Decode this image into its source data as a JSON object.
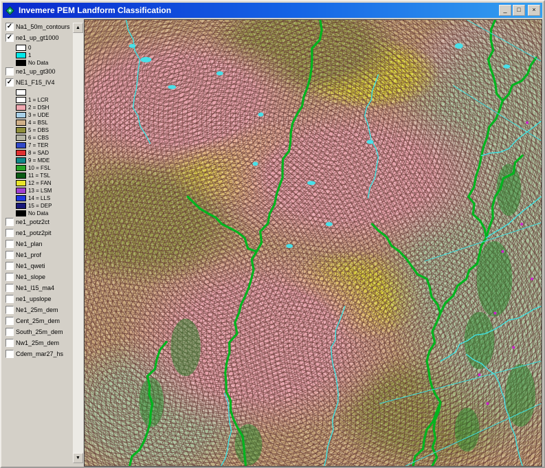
{
  "window": {
    "title": "Invemere PEM Landform Classification"
  },
  "icons": {
    "minimize": "_",
    "maximize": "□",
    "close": "×",
    "scroll_up": "▲",
    "scroll_down": "▼",
    "checkmark": "✓",
    "app_icon": "green-diamond"
  },
  "toc": {
    "layers": [
      {
        "name": "Na1_50m_contours",
        "checked": true,
        "legend": []
      },
      {
        "name": "ne1_up_gt1000",
        "checked": true,
        "legend": [
          {
            "label": "0",
            "color": "#ffffff"
          },
          {
            "label": "1",
            "color": "#00e8e8"
          },
          {
            "label": "No Data",
            "color": "#000000"
          }
        ]
      },
      {
        "name": "ne1_up_gt300",
        "checked": false,
        "legend": []
      },
      {
        "name": "NE1_F15_IV4",
        "checked": true,
        "legend": [
          {
            "label": "",
            "color": "#ffffff"
          },
          {
            "label": "1 = LCR",
            "color": "#ffffff"
          },
          {
            "label": "2 = DSH",
            "color": "#f0a8b0"
          },
          {
            "label": "3 = UDE",
            "color": "#a8d0e8"
          },
          {
            "label": "4 = BSL",
            "color": "#d0b088"
          },
          {
            "label": "5 = DBS",
            "color": "#8f8f3c"
          },
          {
            "label": "6 = CBS",
            "color": "#b4b4a4"
          },
          {
            "label": "7 = TER",
            "color": "#3048c8"
          },
          {
            "label": "8 = SAD",
            "color": "#e03030"
          },
          {
            "label": "9 = MDE",
            "color": "#108888"
          },
          {
            "label": "10 = FSL",
            "color": "#28a428"
          },
          {
            "label": "11 = TSL",
            "color": "#0a5a14"
          },
          {
            "label": "12 = FAN",
            "color": "#e8e428"
          },
          {
            "label": "13 = LSM",
            "color": "#a040d0"
          },
          {
            "label": "14 = LLS",
            "color": "#2038e0"
          },
          {
            "label": "15 = DEP",
            "color": "#181878"
          },
          {
            "label": "No Data",
            "color": "#000000"
          }
        ]
      },
      {
        "name": "ne1_potz2ct",
        "checked": false,
        "legend": []
      },
      {
        "name": "ne1_potz2pit",
        "checked": false,
        "legend": []
      },
      {
        "name": "Ne1_plan",
        "checked": false,
        "legend": []
      },
      {
        "name": "Ne1_prof",
        "checked": false,
        "legend": []
      },
      {
        "name": "Ne1_qweti",
        "checked": false,
        "legend": []
      },
      {
        "name": "Ne1_slope",
        "checked": false,
        "legend": []
      },
      {
        "name": "Ne1_l15_ma4",
        "checked": false,
        "legend": []
      },
      {
        "name": "ne1_upslope",
        "checked": false,
        "legend": []
      },
      {
        "name": "Ne1_25m_dem",
        "checked": false,
        "legend": []
      },
      {
        "name": "Cent_25m_dem",
        "checked": false,
        "legend": []
      },
      {
        "name": "South_25m_dem",
        "checked": false,
        "legend": []
      },
      {
        "name": "Nw1_25m_dem",
        "checked": false,
        "legend": []
      },
      {
        "name": "Cdem_mar27_hs",
        "checked": false,
        "legend": []
      }
    ]
  },
  "map": {
    "palette": {
      "base_tan": "#c9a87c",
      "ridge_pink": "#e6a3ac",
      "fan_yellow": "#d6cf3c",
      "slope_olive": "#9a9c4e",
      "valley_green": "#a9bf9b",
      "contour_line": "rgba(100,55,50,0.5)",
      "stream_green": "#00b41e",
      "stream_cyan": "#3fe3e3",
      "wetland_green": "#1e8c28",
      "lake_cyan": "#49e0e8",
      "dot_magenta": "#cc22cc"
    }
  }
}
